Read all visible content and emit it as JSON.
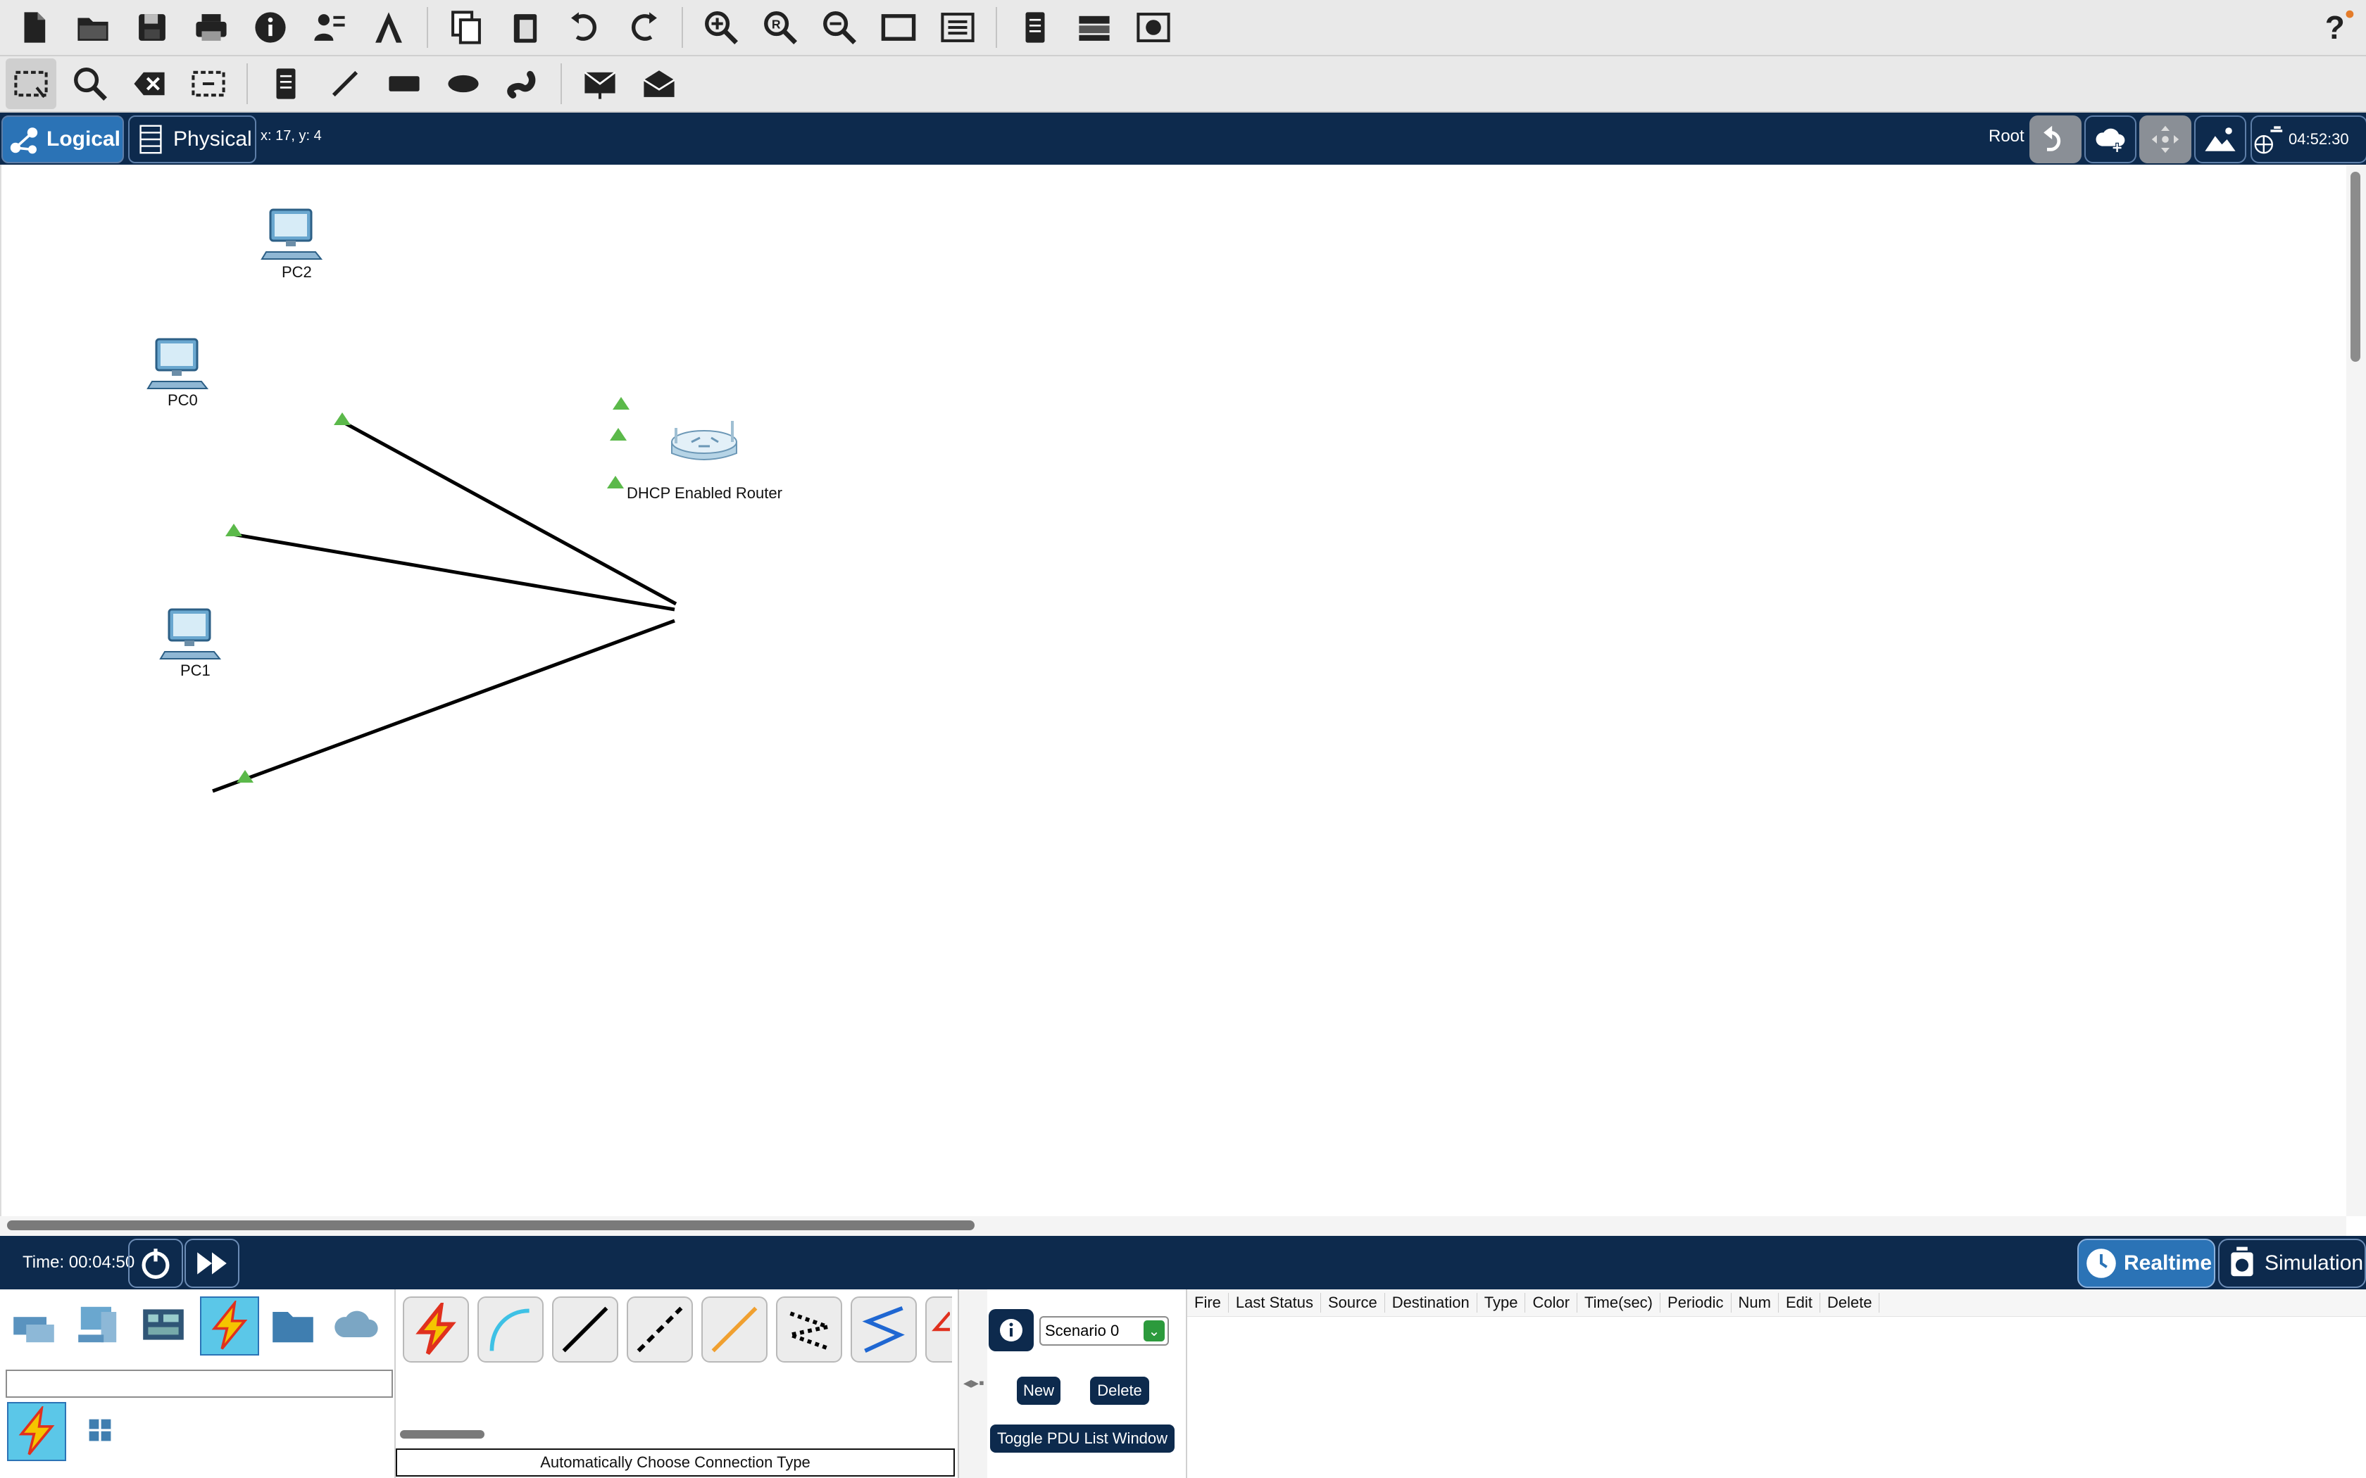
{
  "toolbar_main": {
    "icons": [
      "new-file-icon",
      "open-folder-icon",
      "save-icon",
      "print-icon",
      "info-icon",
      "activity-wizard-icon",
      "custom-device-icon",
      "copy-icon",
      "paste-icon",
      "undo-icon",
      "redo-icon",
      "zoom-in-icon",
      "zoom-reset-icon",
      "zoom-out-icon",
      "drawing-palette-icon",
      "custom-devices-dialog-icon",
      "list-icon",
      "rack-icon",
      "image-icon",
      "help-icon"
    ]
  },
  "toolbar_tools": {
    "icons": [
      "select-icon",
      "inspect-icon",
      "delete-icon",
      "resize-icon",
      "note-icon",
      "line-icon",
      "rectangle-icon",
      "ellipse-icon",
      "freeform-icon",
      "add-simple-pdu-icon",
      "add-complex-pdu-icon"
    ]
  },
  "modebar": {
    "logical_label": "Logical",
    "physical_label": "Physical",
    "coords": "x: 17, y: 4",
    "root_label": "Root",
    "time": "04:52:30"
  },
  "workspace": {
    "devices": [
      {
        "id": "pc2",
        "label": "PC2",
        "type": "pc"
      },
      {
        "id": "pc0",
        "label": "PC0",
        "type": "pc"
      },
      {
        "id": "pc1",
        "label": "PC1",
        "type": "pc"
      },
      {
        "id": "router",
        "label": "DHCP Enabled Router",
        "type": "wireless-router"
      }
    ],
    "link_color": "#000000",
    "port_status_color": "#5bb94a"
  },
  "statusbar": {
    "time_label": "Time: 00:04:50",
    "realtime_label": "Realtime",
    "simulation_label": "Simulation"
  },
  "bottom": {
    "device_search_value": "",
    "connection_description": "Automatically Choose Connection Type",
    "scenario_value": "Scenario 0",
    "new_label": "New",
    "delete_label": "Delete",
    "toggle_label": "Toggle PDU List Window",
    "pdu_columns": [
      "Fire",
      "Last Status",
      "Source",
      "Destination",
      "Type",
      "Color",
      "Time(sec)",
      "Periodic",
      "Num",
      "Edit",
      "Delete"
    ]
  },
  "colors": {
    "navy": "#0d2a4d",
    "accent_blue": "#2b73b6",
    "active_cyan": "#5bc7e8",
    "lightning_red": "#e0301e",
    "lightning_yellow": "#f5c400"
  }
}
